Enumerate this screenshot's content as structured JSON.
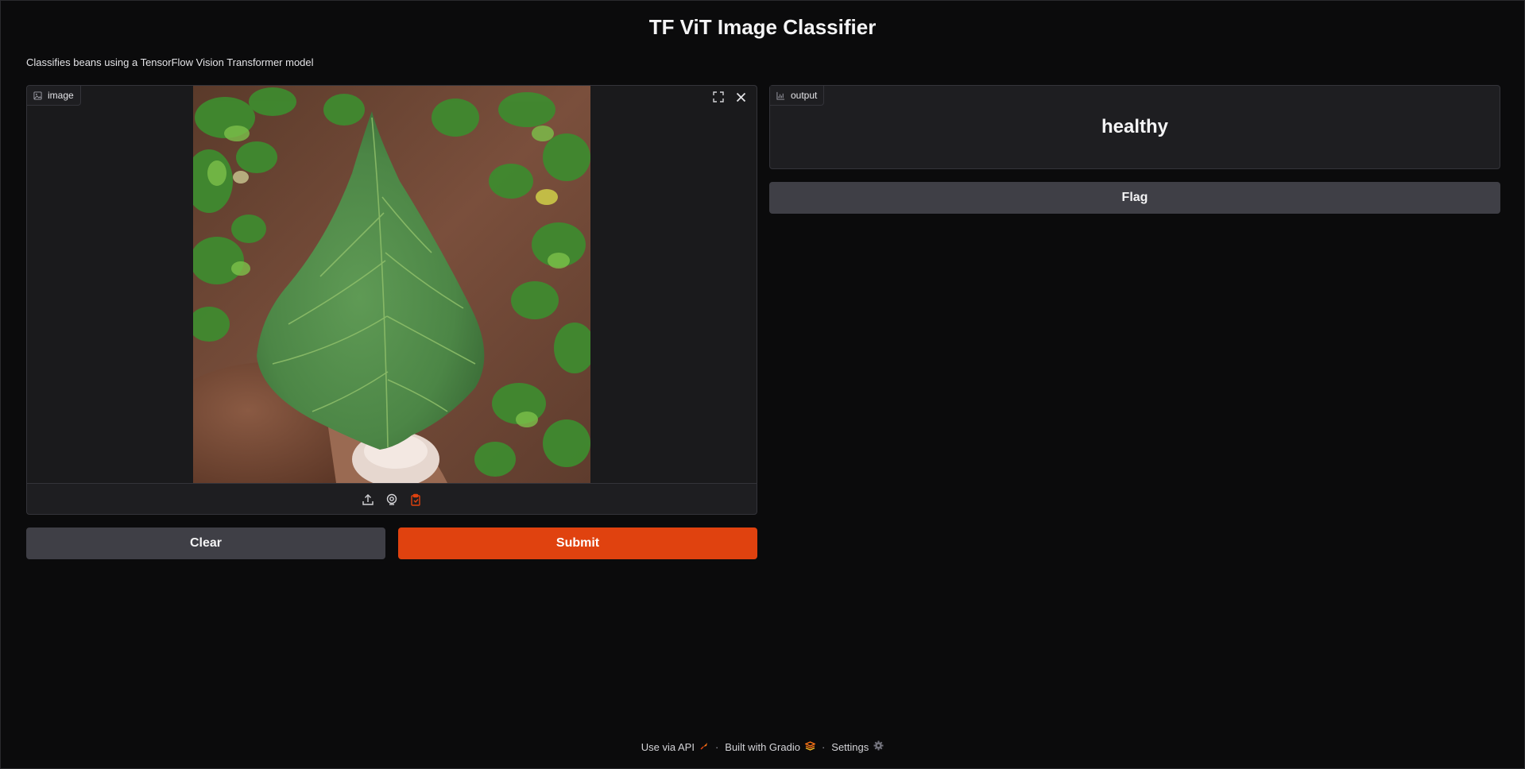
{
  "page": {
    "title": "TF ViT Image Classifier",
    "description": "Classifies beans using a TensorFlow Vision Transformer model"
  },
  "input": {
    "label": "image",
    "icons": [
      "image-icon",
      "fullscreen-icon",
      "close-icon",
      "upload-icon",
      "webcam-icon",
      "clipboard-icon"
    ]
  },
  "output": {
    "label": "output",
    "value": "healthy"
  },
  "buttons": {
    "clear": "Clear",
    "submit": "Submit",
    "flag": "Flag"
  },
  "footer": {
    "api": "Use via API",
    "separator": "·",
    "built": "Built with Gradio",
    "settings": "Settings"
  },
  "colors": {
    "accent": "#e0420f",
    "background": "#0b0b0c",
    "panel": "#1e1e21",
    "button_secondary": "#3f3f46"
  }
}
